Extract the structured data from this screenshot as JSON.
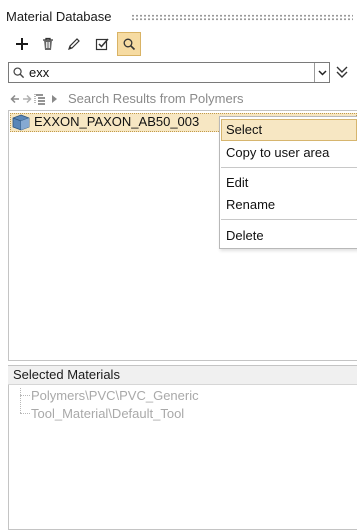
{
  "panel": {
    "title": "Material Database"
  },
  "toolbar": {
    "buttons": [
      {
        "icon": "plus-icon",
        "label": "Add"
      },
      {
        "icon": "trash-icon",
        "label": "Delete"
      },
      {
        "icon": "pencil-icon",
        "label": "Edit"
      },
      {
        "icon": "checklist-icon",
        "label": "Select"
      },
      {
        "icon": "search-icon",
        "label": "Search",
        "active": true
      }
    ]
  },
  "search": {
    "value": "exx",
    "placeholder": ""
  },
  "navigation": {
    "results_label": "Search Results from Polymers"
  },
  "results": [
    {
      "label": "EXXON_PAXON_AB50_003",
      "icon": "material-cube-icon",
      "selected": true
    }
  ],
  "context_menu": {
    "items": [
      {
        "label": "Select",
        "highlighted": true
      },
      {
        "label": "Copy to user area"
      },
      {
        "label": "Edit"
      },
      {
        "label": "Rename"
      },
      {
        "label": "Delete"
      }
    ]
  },
  "selected_materials": {
    "title": "Selected Materials",
    "items": [
      "Polymers\\PVC\\PVC_Generic",
      "Tool_Material\\Default_Tool"
    ]
  },
  "colors": {
    "accent": "#f6dba2",
    "selection": "#f7e7c3",
    "disabled_text": "#a9a9a9"
  }
}
